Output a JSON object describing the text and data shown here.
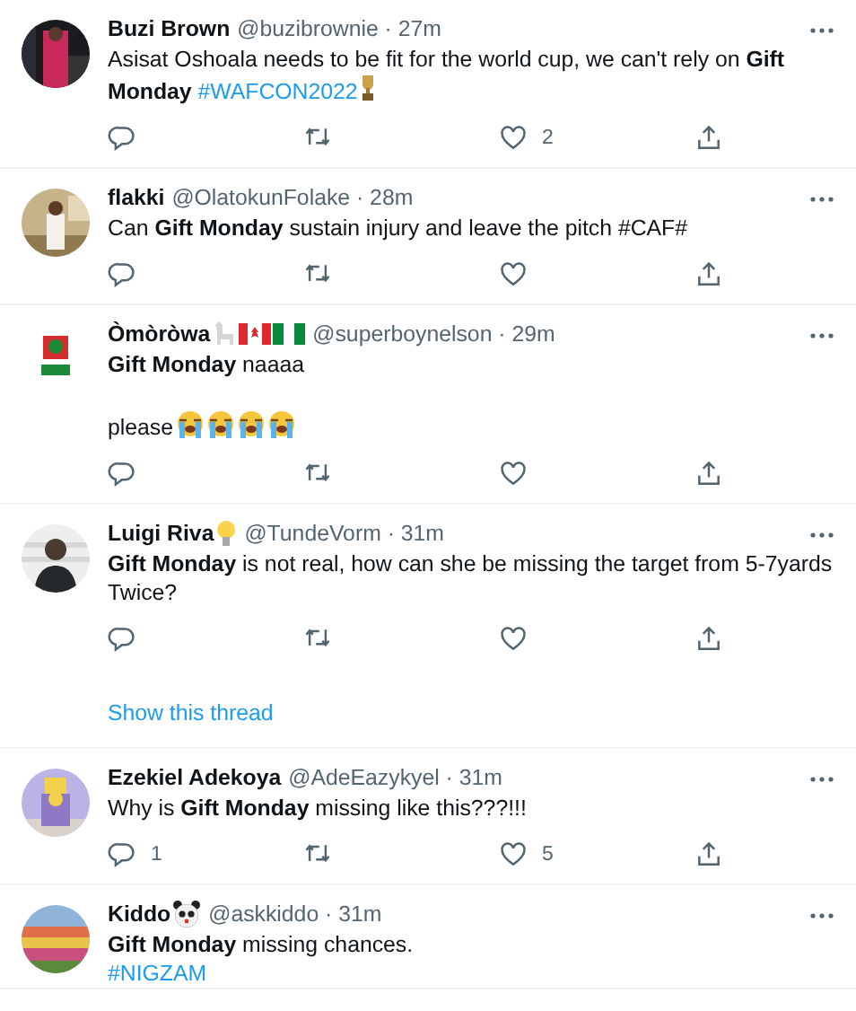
{
  "tweets": [
    {
      "name": "Buzi Brown",
      "meta": "@buzibrownie · 27m",
      "body": [
        [
          [
            {
              "kind": "text",
              "text": "Asisat Oshoala needs to be fit for the world cup, we can't rely on **Gift Monday** "
            },
            {
              "kind": "hashtag",
              "text": "#WAFCON2022"
            },
            {
              "kind": "trophy"
            }
          ]
        ]
      ],
      "actions": [
        {
          "kind": "reply"
        },
        {
          "kind": "retweet"
        },
        {
          "kind": "like",
          "count": "2"
        },
        {
          "kind": "share"
        }
      ]
    },
    {
      "name": "flakki",
      "meta": "@OlatokunFolake · 28m",
      "body": [
        [
          [
            {
              "kind": "text",
              "text": "Can **Gift Monday** sustain injury and leave the pitch #CAF#"
            }
          ]
        ]
      ],
      "actions": [
        {
          "kind": "reply"
        },
        {
          "kind": "retweet"
        },
        {
          "kind": "like"
        },
        {
          "kind": "share"
        }
      ]
    },
    {
      "name": "Òmòròwa",
      "name_emoji": [
        {
          "kind": "llama"
        },
        {
          "kind": "canada-flag"
        },
        {
          "kind": "nigeria-flag"
        }
      ],
      "meta": "@superboynelson · 29m",
      "body": [
        [
          [
            {
              "kind": "text",
              "text": "**Gift Monday** naaaa"
            }
          ]
        ],
        [
          [
            {
              "kind": "text",
              "text": "please"
            },
            {
              "kind": "crying-face"
            },
            {
              "kind": "crying-face"
            },
            {
              "kind": "crying-face"
            },
            {
              "kind": "crying-face"
            }
          ]
        ]
      ],
      "actions": [
        {
          "kind": "reply"
        },
        {
          "kind": "retweet"
        },
        {
          "kind": "like"
        },
        {
          "kind": "share"
        }
      ]
    },
    {
      "name": "Luigi Riva",
      "name_emoji": [
        {
          "kind": "light-bulb"
        }
      ],
      "meta": "@TundeVorm · 31m",
      "body": [
        [
          [
            {
              "kind": "text",
              "text": "**Gift Monday** is not real, how can she be missing the target from 5-7yards Twice?"
            }
          ]
        ]
      ],
      "actions": [
        {
          "kind": "reply"
        },
        {
          "kind": "retweet"
        },
        {
          "kind": "like"
        },
        {
          "kind": "share"
        }
      ],
      "thread_link": "Show this thread"
    },
    {
      "name": "Ezekiel Adekoya",
      "meta": "@AdeEazykyel · 31m",
      "body": [
        [
          [
            {
              "kind": "text",
              "text": "Why is **Gift Monday** missing like this???!!!"
            }
          ]
        ]
      ],
      "actions": [
        {
          "kind": "reply",
          "count": "1"
        },
        {
          "kind": "retweet"
        },
        {
          "kind": "like",
          "count": "5"
        },
        {
          "kind": "share"
        }
      ]
    },
    {
      "name": "Kiddo",
      "name_emoji": [
        {
          "kind": "panda"
        }
      ],
      "meta": "@askkiddo · 31m",
      "body": [
        [
          [
            {
              "kind": "text",
              "text": "**Gift Monday** missing chances."
            }
          ],
          [
            {
              "kind": "hashtag",
              "text": "#NIGZAM"
            }
          ]
        ]
      ]
    }
  ]
}
